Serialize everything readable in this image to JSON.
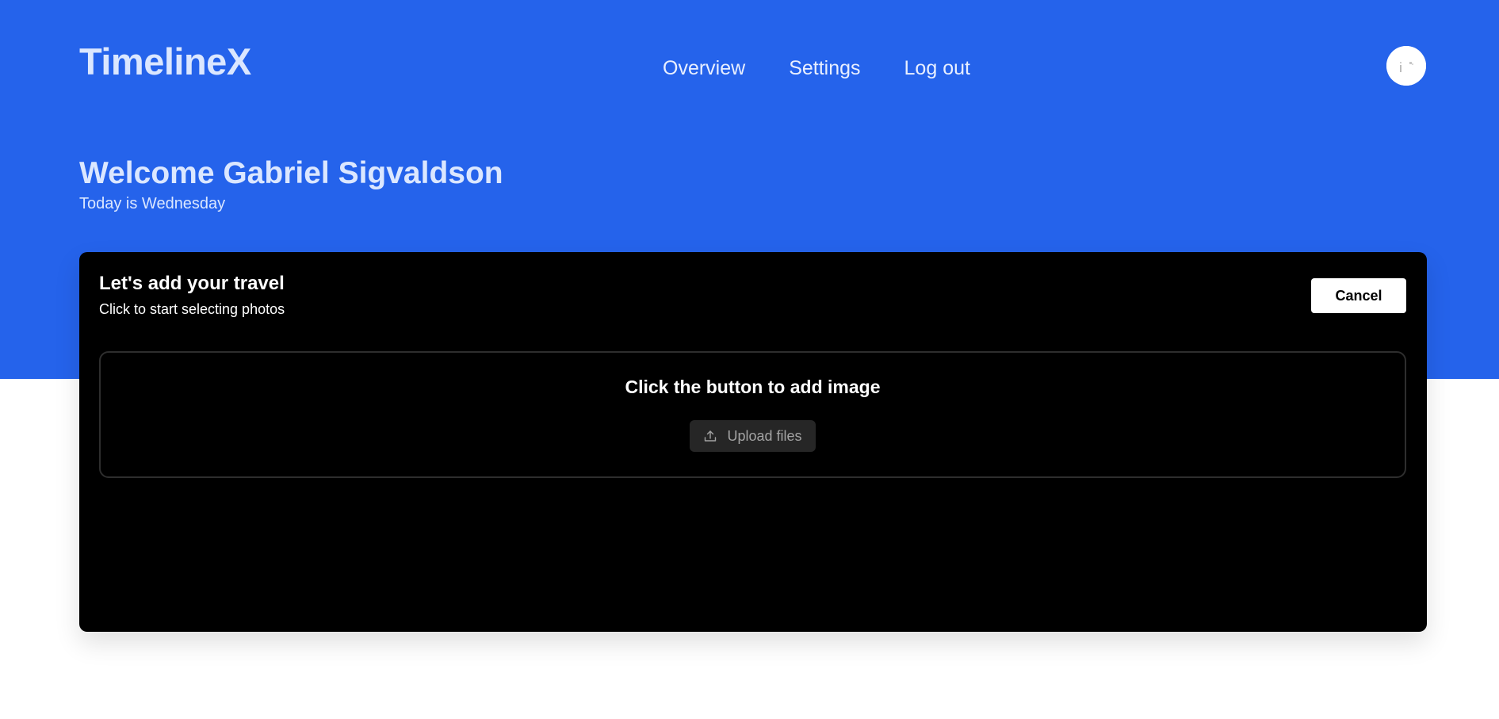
{
  "header": {
    "brand": "TimelineX",
    "nav": [
      {
        "label": "Overview"
      },
      {
        "label": "Settings"
      },
      {
        "label": "Log out"
      }
    ],
    "avatar_icon": "user-avatar-icon"
  },
  "greeting": {
    "title": "Welcome Gabriel Sigvaldson",
    "subtitle": "Today is Wednesday"
  },
  "panel": {
    "title": "Let's add your travel",
    "subtitle": "Click to start selecting photos",
    "cancel_label": "Cancel",
    "dropzone": {
      "title": "Click the button to add image",
      "upload_label": "Upload files",
      "upload_icon": "upload-icon"
    }
  },
  "colors": {
    "hero_background": "#2563eb",
    "panel_background": "#000000",
    "upload_button_background": "#262626"
  }
}
